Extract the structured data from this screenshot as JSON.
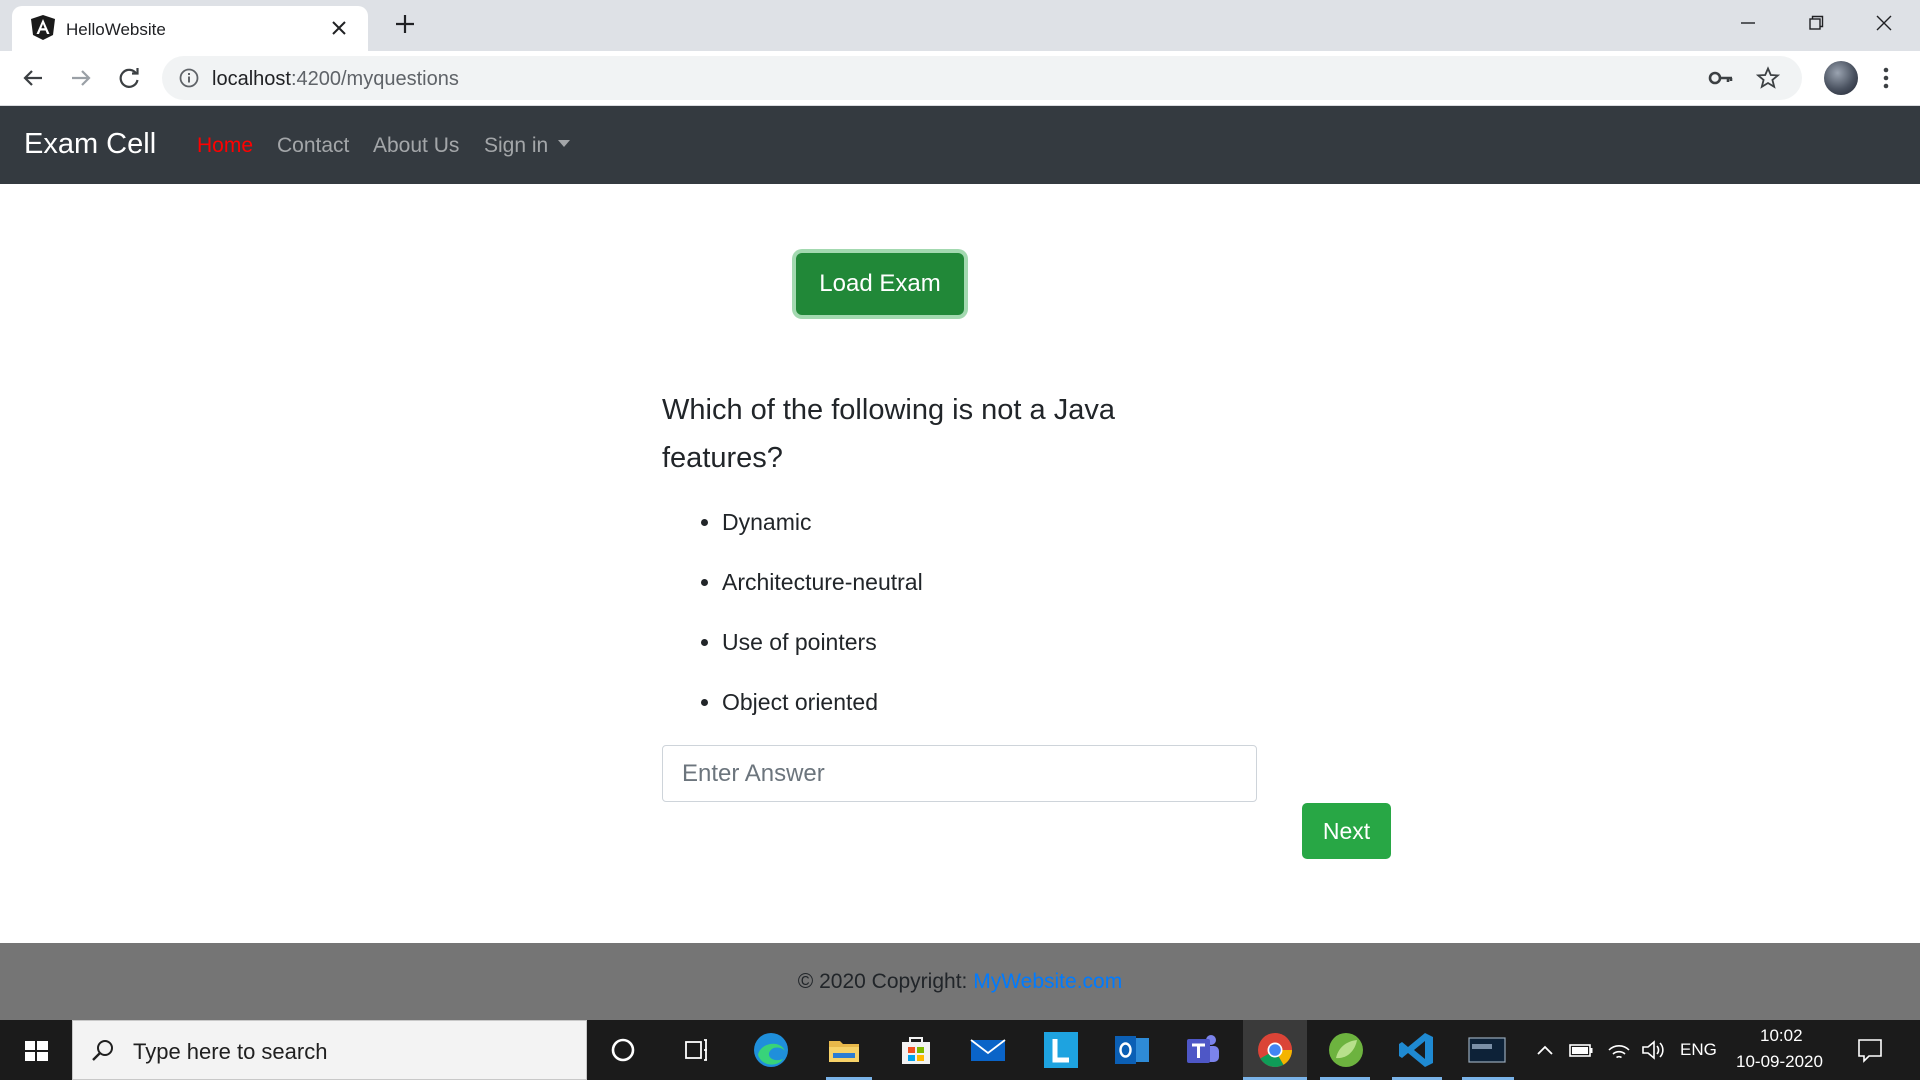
{
  "browser": {
    "tab_title": "HelloWebsite",
    "url_host": "localhost",
    "url_path": ":4200/myquestions"
  },
  "navbar": {
    "brand": "Exam Cell",
    "links": [
      {
        "label": "Home",
        "active": true
      },
      {
        "label": "Contact",
        "active": false
      },
      {
        "label": "About Us",
        "active": false
      },
      {
        "label": "Sign in",
        "dropdown": true
      }
    ]
  },
  "main": {
    "load_button": "Load Exam",
    "question": "Which of the following is not a Java features?",
    "options": [
      "Dynamic",
      "Architecture-neutral",
      "Use of pointers",
      "Object oriented"
    ],
    "answer_placeholder": "Enter Answer",
    "next_button": "Next"
  },
  "footer": {
    "copyright_prefix": "© 2020 Copyright:",
    "link_text": "MyWebsite.com"
  },
  "taskbar": {
    "search_placeholder": "Type here to search",
    "pinned_apps": [
      "cortana-icon",
      "task-view-icon",
      "edge-icon",
      "file-explorer-icon",
      "store-icon",
      "mail-icon",
      "l-app-icon",
      "outlook-icon",
      "teams-icon",
      "chrome-icon",
      "spring-icon",
      "vscode-icon",
      "mysql-icon"
    ],
    "language": "ENG",
    "time": "10:02",
    "date": "10-09-2020"
  },
  "colors": {
    "navbar_bg": "#343a40",
    "active_link": "#ff0000",
    "success": "#28a745",
    "footer_bg": "#757575",
    "link": "#007bff"
  }
}
